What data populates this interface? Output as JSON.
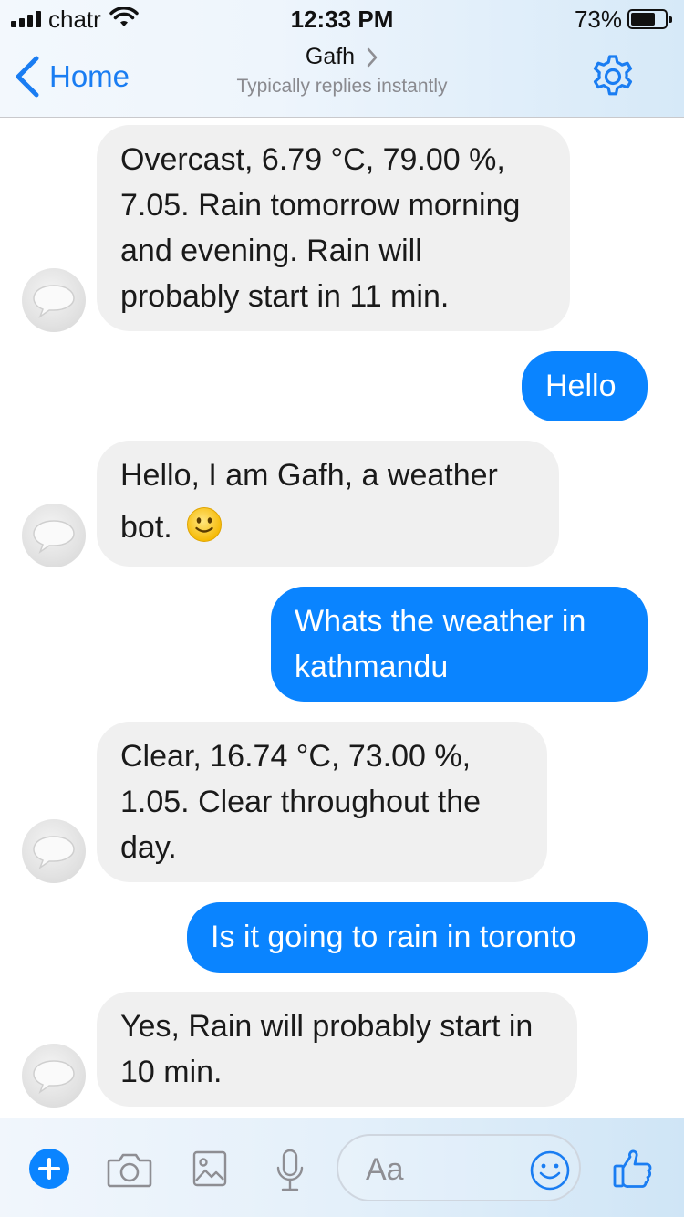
{
  "status_bar": {
    "carrier": "chatr",
    "time": "12:33 PM",
    "battery_percent": "73%",
    "battery_level": 0.73
  },
  "nav": {
    "back_label": "Home",
    "title": "Gafh",
    "subtitle": "Typically replies instantly",
    "settings_icon": "gear-icon"
  },
  "messages": [
    {
      "from": "bot",
      "text": "Overcast, 6.79 °C, 79.00 %, 7.05. Rain tomorrow morning and evening. Rain will probably start in 11 min."
    },
    {
      "from": "me",
      "text": "Hello"
    },
    {
      "from": "bot",
      "text": "Hello, I am Gafh, a weather bot.",
      "emoji": "slightly-smiling-face"
    },
    {
      "from": "me",
      "text": "Whats the weather in kathmandu"
    },
    {
      "from": "bot",
      "text": "Clear, 16.74 °C, 73.00 %, 1.05. Clear throughout the day."
    },
    {
      "from": "me",
      "text": "Is it going to rain in toronto"
    },
    {
      "from": "bot",
      "text": "Yes,  Rain will probably start in 10 min."
    }
  ],
  "composer": {
    "placeholder": "Aa",
    "icons": [
      "plus-icon",
      "camera-icon",
      "image-icon",
      "microphone-icon",
      "emoji-icon",
      "thumbs-up-icon"
    ]
  },
  "colors": {
    "accent": "#0a84ff",
    "link": "#1a7df2",
    "bot_bubble": "#f0f0f0",
    "subtitle": "#8a8a8f"
  }
}
